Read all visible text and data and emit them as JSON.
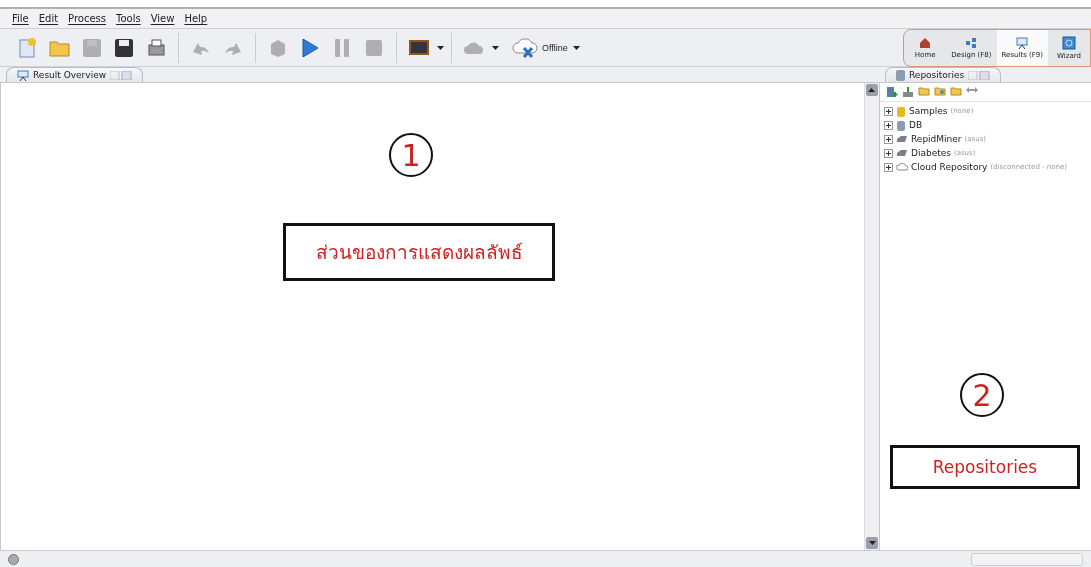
{
  "menu": [
    "File",
    "Edit",
    "Process",
    "Tools",
    "View",
    "Help"
  ],
  "toolbar": [
    {
      "kind": "new",
      "disabled": false
    },
    {
      "kind": "open",
      "disabled": false
    },
    {
      "kind": "save",
      "disabled": true
    },
    {
      "kind": "saveas",
      "disabled": false
    },
    {
      "kind": "print",
      "disabled": false
    },
    {
      "kind": "sep"
    },
    {
      "kind": "undo",
      "disabled": true
    },
    {
      "kind": "redo",
      "disabled": true
    },
    {
      "kind": "sep"
    },
    {
      "kind": "cube",
      "disabled": true
    },
    {
      "kind": "play",
      "disabled": false
    },
    {
      "kind": "pause",
      "disabled": true
    },
    {
      "kind": "stop",
      "disabled": true
    },
    {
      "kind": "sep"
    },
    {
      "kind": "board",
      "disabled": false
    },
    {
      "kind": "caret"
    },
    {
      "kind": "sep"
    },
    {
      "kind": "cloud",
      "disabled": true
    },
    {
      "kind": "caret"
    }
  ],
  "connection": {
    "label": "Offline"
  },
  "perspectives": [
    {
      "kind": "home",
      "label": "Home",
      "selected": false
    },
    {
      "kind": "design",
      "label": "Design (F8)",
      "selected": false
    },
    {
      "kind": "results",
      "label": "Results (F9)",
      "selected": true
    },
    {
      "kind": "wizard",
      "label": "Wizard",
      "selected": false
    }
  ],
  "left_tab": {
    "label": "Result Overview"
  },
  "right_tab": {
    "label": "Repositories"
  },
  "repo_toolbar": [
    {
      "kind": "add"
    },
    {
      "kind": "import"
    },
    {
      "kind": "folder"
    },
    {
      "kind": "refresh"
    },
    {
      "kind": "folder"
    },
    {
      "kind": "arrows"
    }
  ],
  "repositories": [
    {
      "kind": "samples",
      "name": "Samples",
      "detail": "(none)",
      "expanded": false
    },
    {
      "kind": "db",
      "name": "DB",
      "expanded": false
    },
    {
      "kind": "drive",
      "name": "RepidMiner",
      "detail": "(asus)",
      "expanded": false
    },
    {
      "kind": "drive",
      "name": "Diabetes",
      "detail": "(asus)",
      "expanded": false
    },
    {
      "kind": "cloud",
      "name": "Cloud Repository",
      "detail": "(disconnected - none)",
      "expanded": false
    }
  ],
  "annotations": [
    {
      "number": "1",
      "label": "ส่วนของการแสดงผลลัพธ์"
    },
    {
      "number": "2",
      "label": "Repositories"
    }
  ]
}
